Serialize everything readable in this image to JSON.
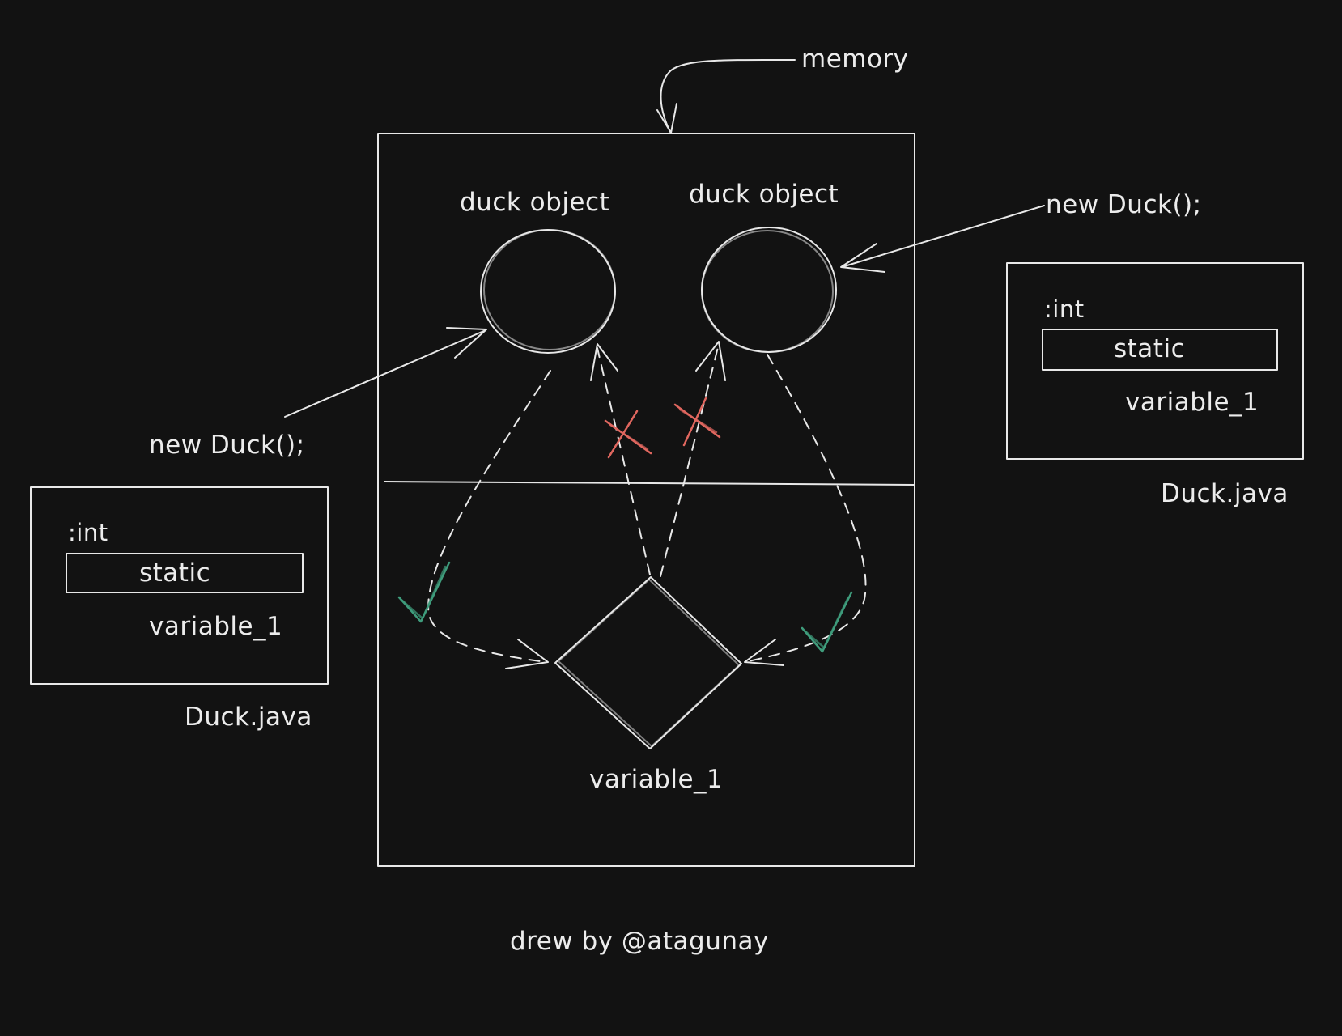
{
  "memory": {
    "label": "memory",
    "duck_object_left_label": "duck object",
    "duck_object_right_label": "duck object",
    "variable_label": "variable_1"
  },
  "left_ref": {
    "new_label": "new Duck();",
    "class_box": {
      "type_label": ":int",
      "modifier_label": "static",
      "variable_label": "variable_1",
      "file_label": "Duck.java"
    }
  },
  "right_ref": {
    "new_label": "new Duck();",
    "class_box": {
      "type_label": ":int",
      "modifier_label": "static",
      "variable_label": "variable_1",
      "file_label": "Duck.java"
    }
  },
  "credit": "drew by @atagunay",
  "colors": {
    "background": "#121212",
    "stroke": "#e8e8e8",
    "cross": "#e0675f",
    "check": "#3f9c7c"
  }
}
